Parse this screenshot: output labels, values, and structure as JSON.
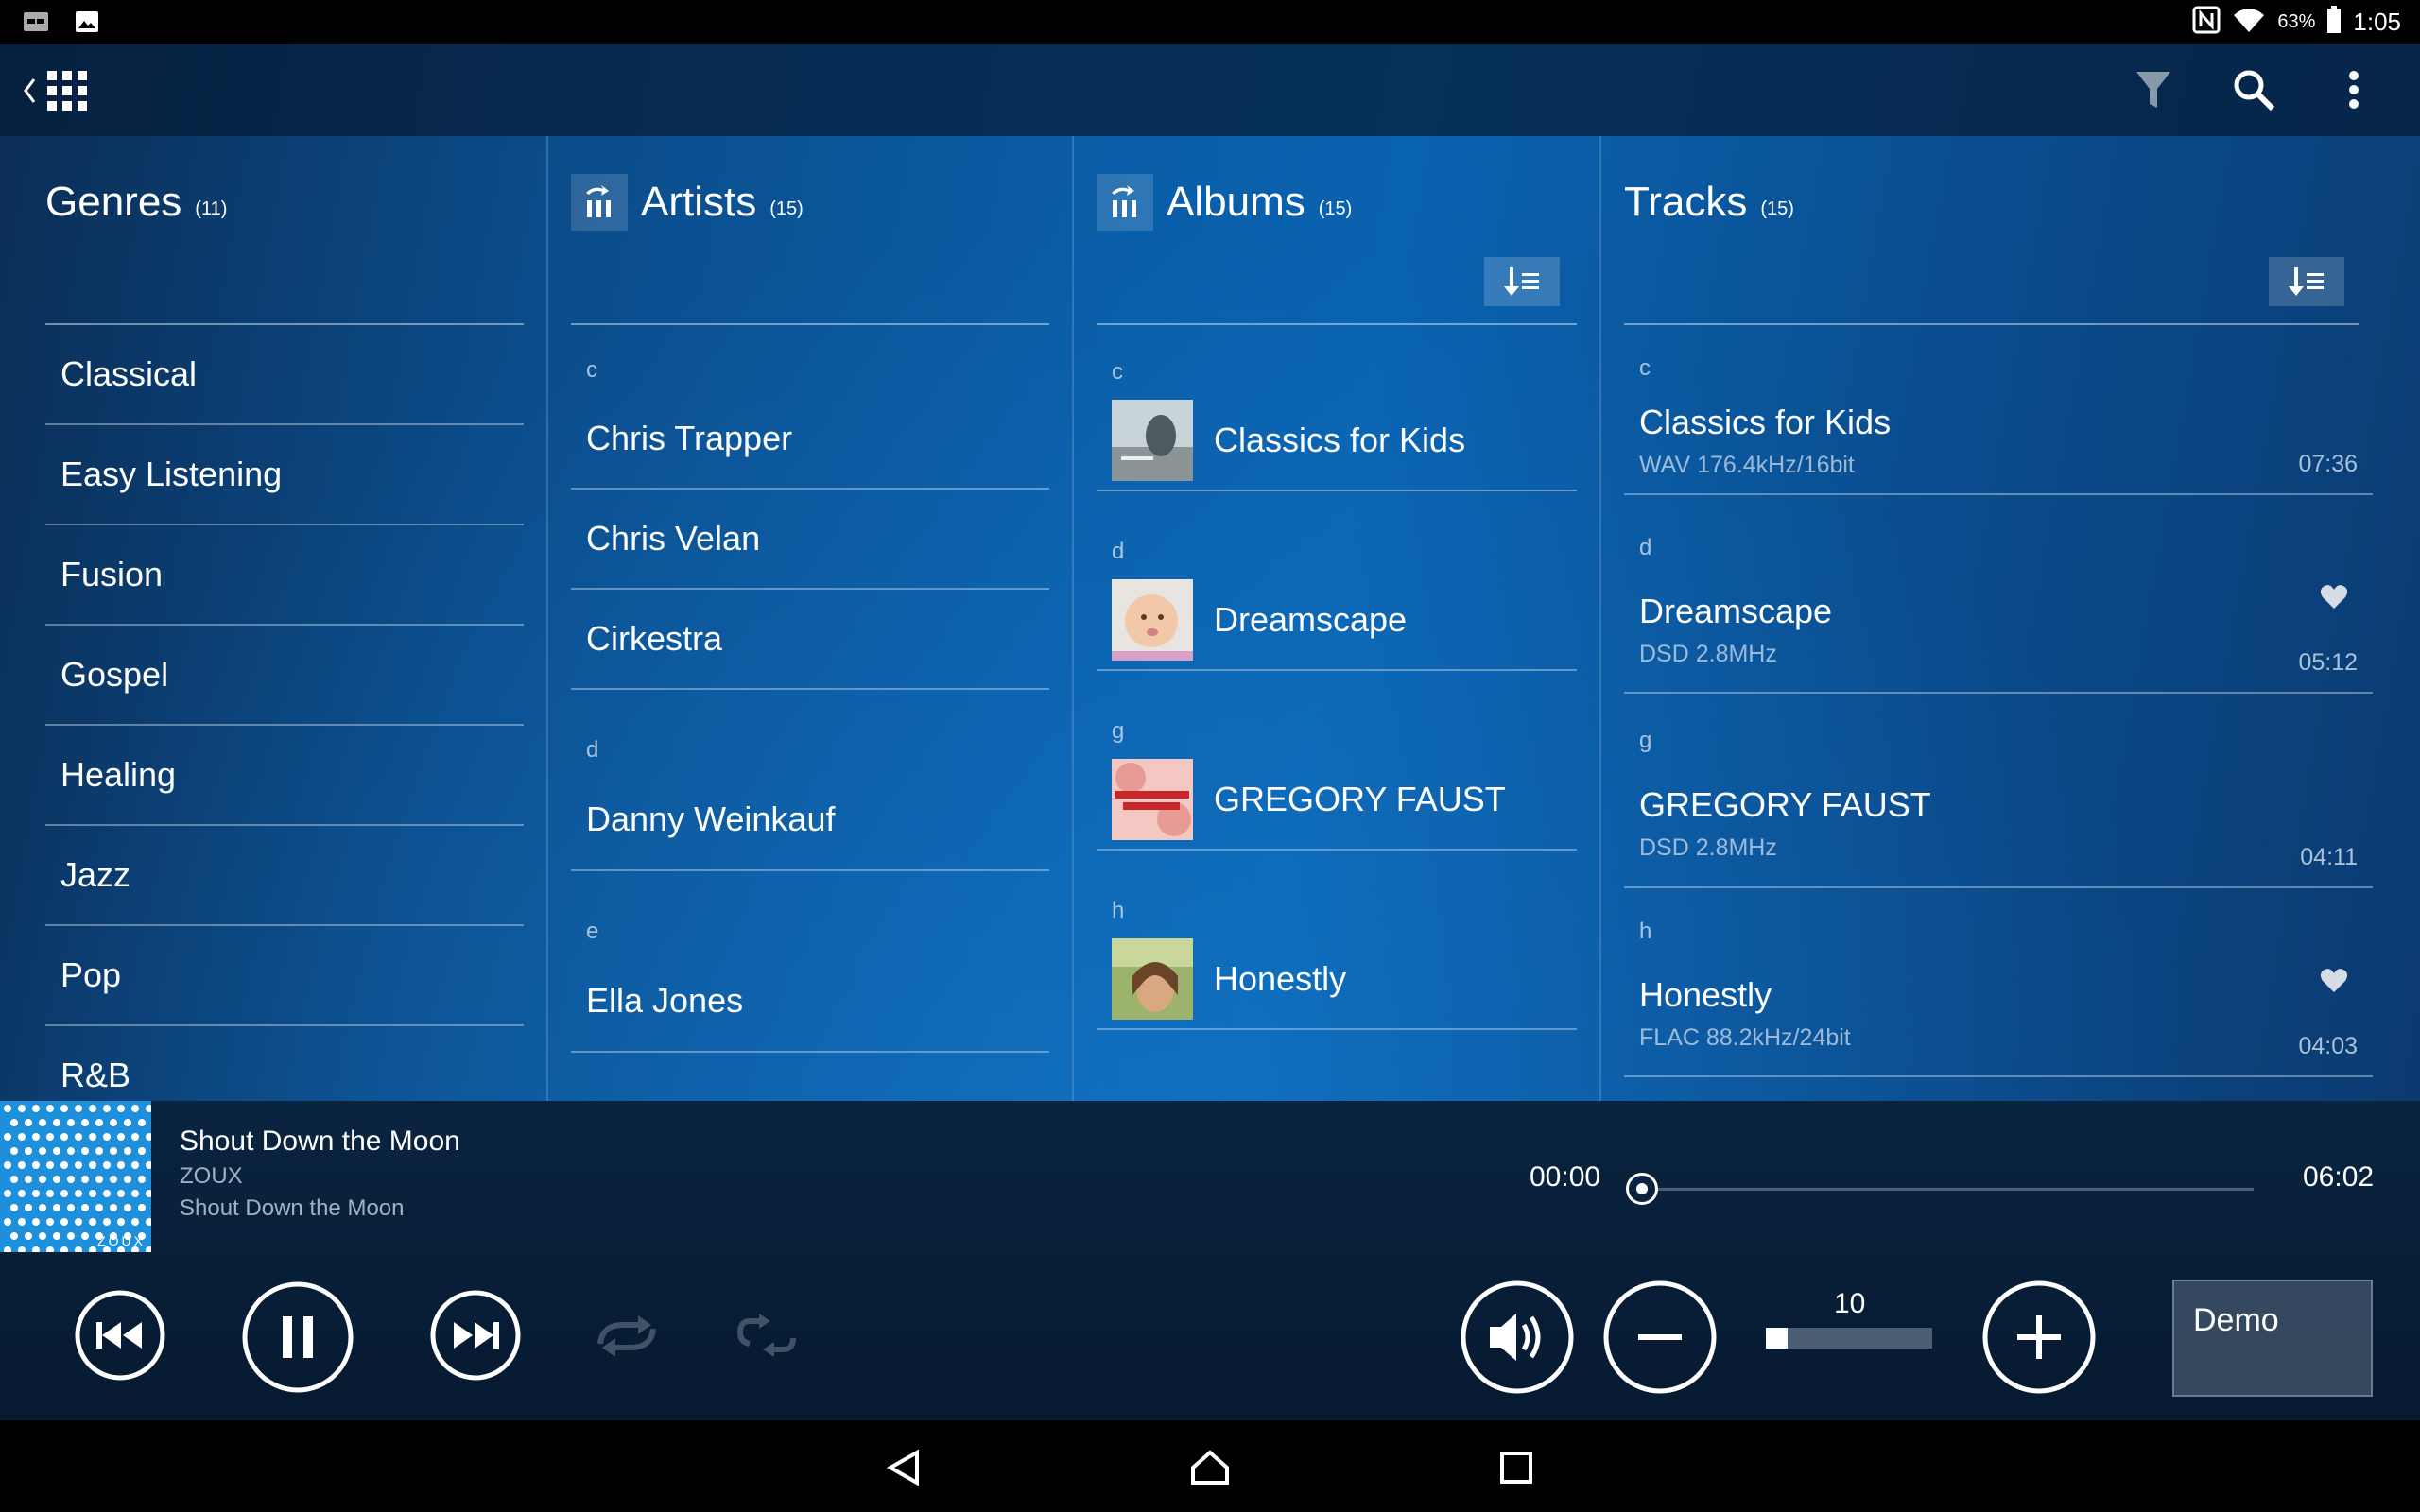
{
  "status_bar": {
    "battery": "63%",
    "time": "1:05"
  },
  "columns": {
    "genres": {
      "title": "Genres",
      "count": "(11)",
      "items": [
        "Classical",
        "Easy Listening",
        "Fusion",
        "Gospel",
        "Healing",
        "Jazz",
        "Pop",
        "R&B"
      ]
    },
    "artists": {
      "title": "Artists",
      "count": "(15)",
      "groups": [
        {
          "letter": "c",
          "items": [
            "Chris Trapper",
            "Chris Velan",
            "Cirkestra"
          ]
        },
        {
          "letter": "d",
          "items": [
            "Danny Weinkauf"
          ]
        },
        {
          "letter": "e",
          "items": [
            "Ella Jones"
          ]
        }
      ]
    },
    "albums": {
      "title": "Albums",
      "count": "(15)",
      "groups": [
        {
          "letter": "c",
          "items": [
            "Classics for Kids"
          ]
        },
        {
          "letter": "d",
          "items": [
            "Dreamscape"
          ]
        },
        {
          "letter": "g",
          "items": [
            "GREGORY FAUST"
          ]
        },
        {
          "letter": "h",
          "items": [
            "Honestly"
          ]
        }
      ]
    },
    "tracks": {
      "title": "Tracks",
      "count": "(15)",
      "groups": [
        {
          "letter": "c",
          "title": "Classics for Kids",
          "format": "WAV 176.4kHz/16bit",
          "duration": "07:36",
          "favorite": false
        },
        {
          "letter": "d",
          "title": "Dreamscape",
          "format": "DSD 2.8MHz",
          "duration": "05:12",
          "favorite": true
        },
        {
          "letter": "g",
          "title": "GREGORY FAUST",
          "format": "DSD 2.8MHz",
          "duration": "04:11",
          "favorite": false
        },
        {
          "letter": "h",
          "title": "Honestly",
          "format": "FLAC 88.2kHz/24bit",
          "duration": "04:03",
          "favorite": true
        }
      ]
    }
  },
  "now_playing": {
    "title": "Shout Down the Moon",
    "artist": "ZOUX",
    "album": "Shout Down the Moon",
    "current_time": "00:00",
    "total_time": "06:02",
    "progress": 0,
    "art_label": "ZOUX"
  },
  "volume": {
    "level": "10",
    "fill_fraction": 0.13
  },
  "demo_button": "Demo",
  "colors": {
    "accent": "#0a63b0",
    "player_bg": "#061a30",
    "album_art_blue": "#1e8fdb"
  }
}
